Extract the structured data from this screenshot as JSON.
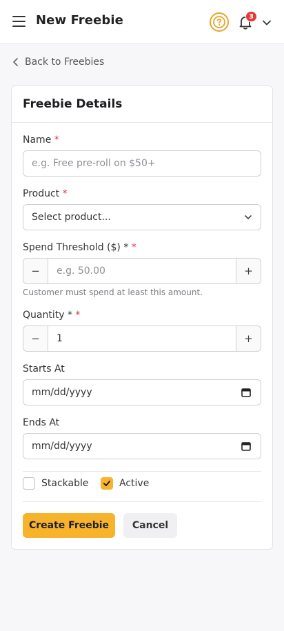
{
  "header": {
    "title": "New Freebie",
    "notification_count": "3",
    "icons": {
      "menu": "hamburger-icon",
      "help": "help-circle-icon",
      "notifications": "bell-icon",
      "account": "chevron-down-icon"
    },
    "accent_color": "#e7a52a"
  },
  "nav": {
    "back_label": "Back to Freebies"
  },
  "card": {
    "title": "Freebie Details"
  },
  "form": {
    "name": {
      "label": "Name",
      "required": "*",
      "placeholder": "e.g. Free pre-roll on $50+"
    },
    "product": {
      "label": "Product",
      "required": "*",
      "selected": "Select product..."
    },
    "threshold": {
      "label": "Spend Threshold ($) *",
      "required": "*",
      "placeholder": "e.g. 50.00",
      "help": "Customer must spend at least this amount.",
      "minus": "−",
      "plus": "+"
    },
    "quantity": {
      "label": "Quantity *",
      "required": "*",
      "value": "1",
      "minus": "−",
      "plus": "+"
    },
    "starts_at": {
      "label": "Starts At",
      "value": "mm/dd/yyyy"
    },
    "ends_at": {
      "label": "Ends At",
      "value": "mm/dd/yyyy"
    },
    "stackable": {
      "label": "Stackable",
      "checked": false
    },
    "active": {
      "label": "Active",
      "checked": true
    }
  },
  "actions": {
    "submit": "Create Freebie",
    "cancel": "Cancel"
  },
  "colors": {
    "primary": "#f7b32b",
    "required": "#dc3545",
    "badge": "#e53935"
  }
}
